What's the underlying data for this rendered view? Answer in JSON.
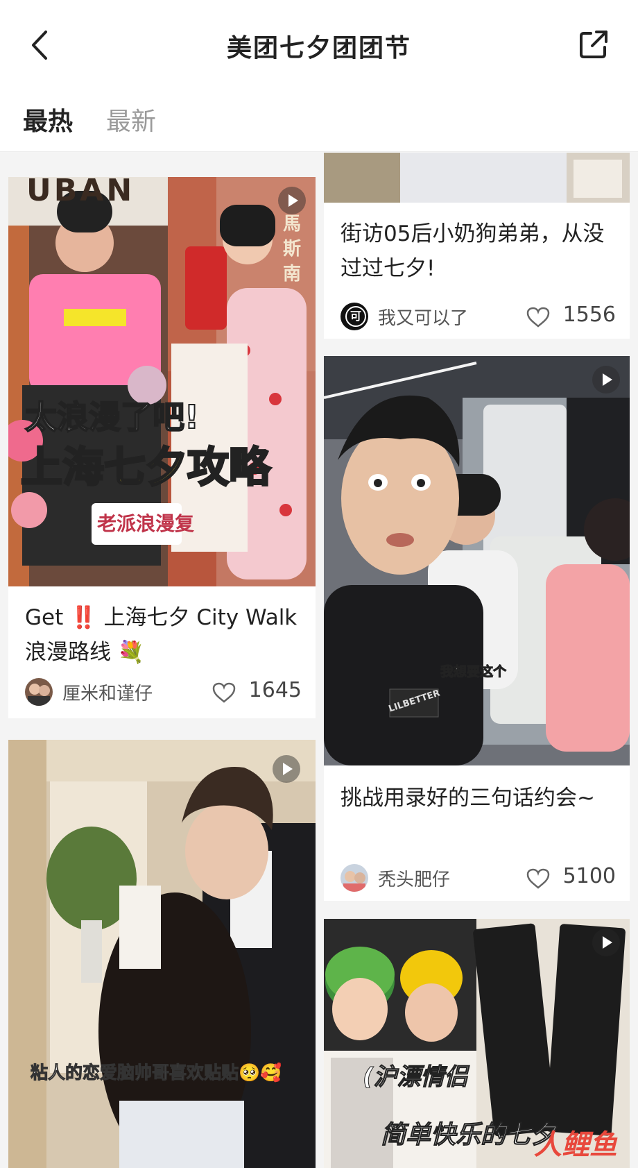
{
  "header": {
    "title": "美团七夕团团节",
    "back_icon": "chevron-left-icon",
    "share_icon": "share-icon"
  },
  "tabs": [
    {
      "label": "最热",
      "active": true
    },
    {
      "label": "最新",
      "active": false
    }
  ],
  "cards": [
    {
      "title": "Get ‼️ 上海七夕 City Walk 浪漫路线 💐",
      "author": "厘米和谨仔",
      "likes": "1645",
      "cover_text_1": "太浪漫了吧!",
      "cover_text_2": "上海七夕攻略",
      "cover_sign": "老派浪漫复",
      "cover_store_text": "UBAN",
      "street_sign": "馬斯南",
      "video": true
    },
    {
      "title": "街访05后小奶狗弟弟，从没过过七夕!",
      "author": "我又可以了",
      "likes": "1556",
      "avatar_char": "可"
    },
    {
      "title": "挑战用录好的三句话约会~",
      "author": "秃头肥仔",
      "likes": "5100",
      "cover_caption": "我想要这个",
      "shirt_text": "LILBETTER",
      "video": true
    },
    {
      "cover_caption": "粘人的恋爱脑帅哥喜欢贴贴🥺🥰",
      "video": true
    },
    {
      "cover_caption_1": "(沪漂情侣",
      "cover_caption_2": "简单快乐的七夕",
      "video": true
    }
  ],
  "watermark": "人鲤鱼",
  "colors": {
    "accent_red": "#e8483c",
    "text_primary": "#222222",
    "text_secondary": "#9a9a9a"
  }
}
